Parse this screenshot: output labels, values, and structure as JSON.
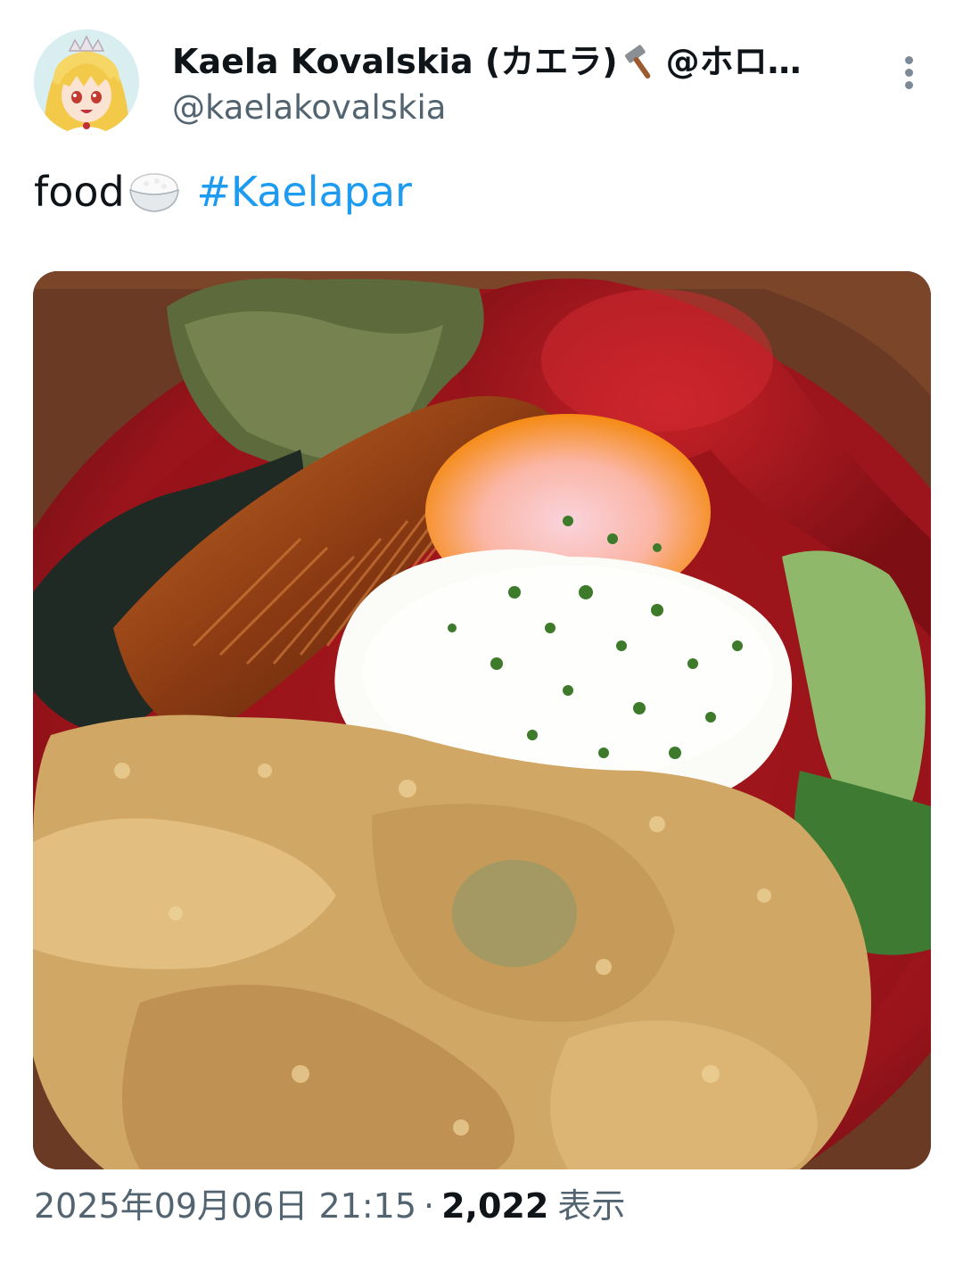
{
  "author": {
    "display_name": "Kaela Kovalskia (カエラ)",
    "name_suffix": "@ホロ…",
    "handle": "@kaelakovalskia",
    "avatar_icon": "vtuber-avatar",
    "badge_icon": "hammer-icon"
  },
  "post": {
    "text": "food",
    "emoji_icon": "rice-bowl-icon",
    "hashtag": "#Kaelapar"
  },
  "media": {
    "type": "photo"
  },
  "meta": {
    "timestamp": "2025年09月06日 21:15",
    "separator": "·",
    "views_count": "2,022",
    "views_label": "表示"
  },
  "colors": {
    "link": "#1d9bf0",
    "secondary_text": "#536471",
    "primary_text": "#0f1419"
  }
}
